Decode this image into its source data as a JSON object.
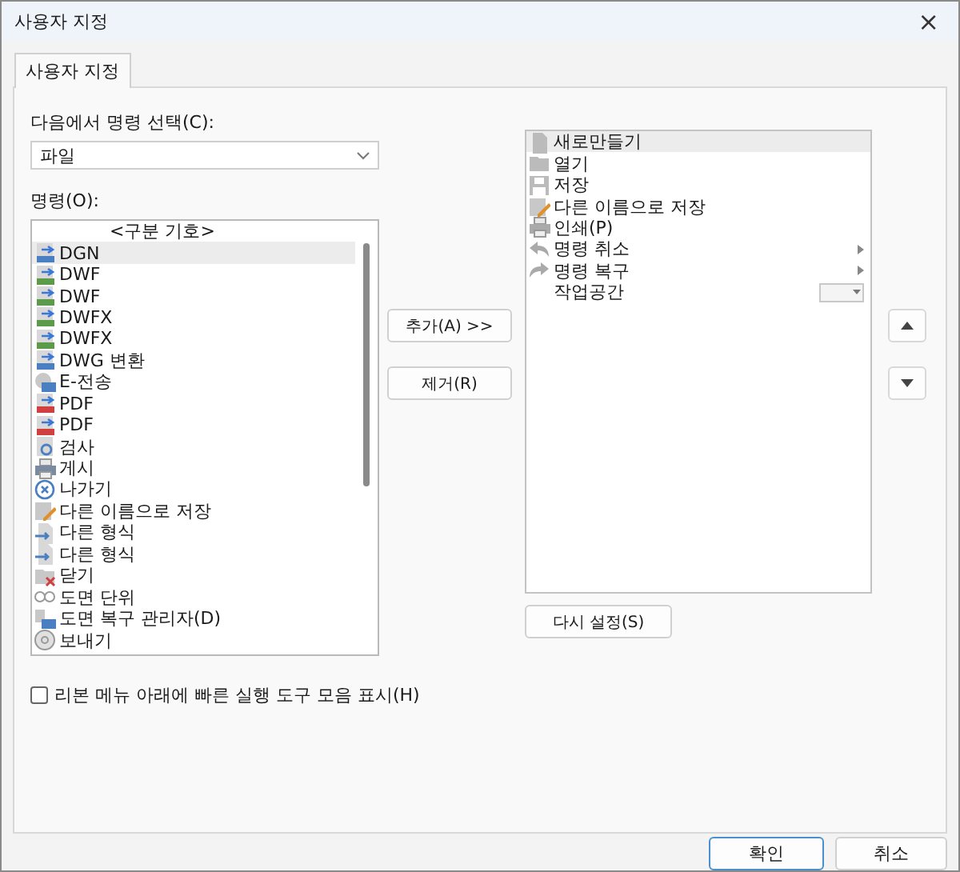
{
  "window": {
    "title": "사용자 지정",
    "close": "×"
  },
  "tabs": [
    {
      "label": "사용자 지정",
      "selected": true
    }
  ],
  "source": {
    "label": "다음에서 명령 선택(C):",
    "value": "파일"
  },
  "commands": {
    "label": "명령(O):",
    "items": [
      {
        "label": "<구분 기호>",
        "kind": "separator",
        "selected": false
      },
      {
        "label": "DGN",
        "kind": "command",
        "selected": true
      },
      {
        "label": "DWF",
        "kind": "command",
        "selected": false
      },
      {
        "label": "DWF",
        "kind": "command",
        "selected": false
      },
      {
        "label": "DWFX",
        "kind": "command",
        "selected": false
      },
      {
        "label": "DWFX",
        "kind": "command",
        "selected": false
      },
      {
        "label": "DWG 변환",
        "kind": "command",
        "selected": false
      },
      {
        "label": "E-전송",
        "kind": "command",
        "selected": false
      },
      {
        "label": "PDF",
        "kind": "command",
        "selected": false
      },
      {
        "label": "PDF",
        "kind": "command",
        "selected": false
      },
      {
        "label": "검사",
        "kind": "command",
        "selected": false
      },
      {
        "label": "게시",
        "kind": "command",
        "selected": false
      },
      {
        "label": "나가기",
        "kind": "command",
        "selected": false
      },
      {
        "label": "다른 이름으로 저장",
        "kind": "command",
        "selected": false
      },
      {
        "label": "다른 형식",
        "kind": "command",
        "selected": false
      },
      {
        "label": "다른 형식",
        "kind": "command",
        "selected": false
      },
      {
        "label": "닫기",
        "kind": "command",
        "selected": false
      },
      {
        "label": "도면 단위",
        "kind": "command",
        "selected": false
      },
      {
        "label": "도면 복구 관리자(D)",
        "kind": "command",
        "selected": false
      },
      {
        "label": "보내기",
        "kind": "command",
        "selected": false
      }
    ]
  },
  "add_button": "추가(A) >>",
  "remove_button": "제거(R)",
  "toolbar": {
    "items": [
      {
        "label": "새로만들기",
        "kind": "command",
        "selected": true
      },
      {
        "label": "열기",
        "kind": "command",
        "selected": false
      },
      {
        "label": "저장",
        "kind": "command",
        "selected": false
      },
      {
        "label": "다른 이름으로 저장",
        "kind": "command",
        "selected": false
      },
      {
        "label": "인쇄(P)",
        "kind": "command",
        "selected": false
      },
      {
        "label": "명령 취소",
        "kind": "submenu",
        "selected": false
      },
      {
        "label": "명령 복구",
        "kind": "submenu",
        "selected": false
      },
      {
        "label": "작업공간",
        "kind": "dropdown",
        "selected": false
      }
    ]
  },
  "reset_button": "다시 설정(S)",
  "show_below_ribbon": {
    "label": "리본 메뉴 아래에 빠른 실행 도구 모음 표시(H)",
    "checked": false
  },
  "buttons": [
    "확인",
    "취소"
  ]
}
